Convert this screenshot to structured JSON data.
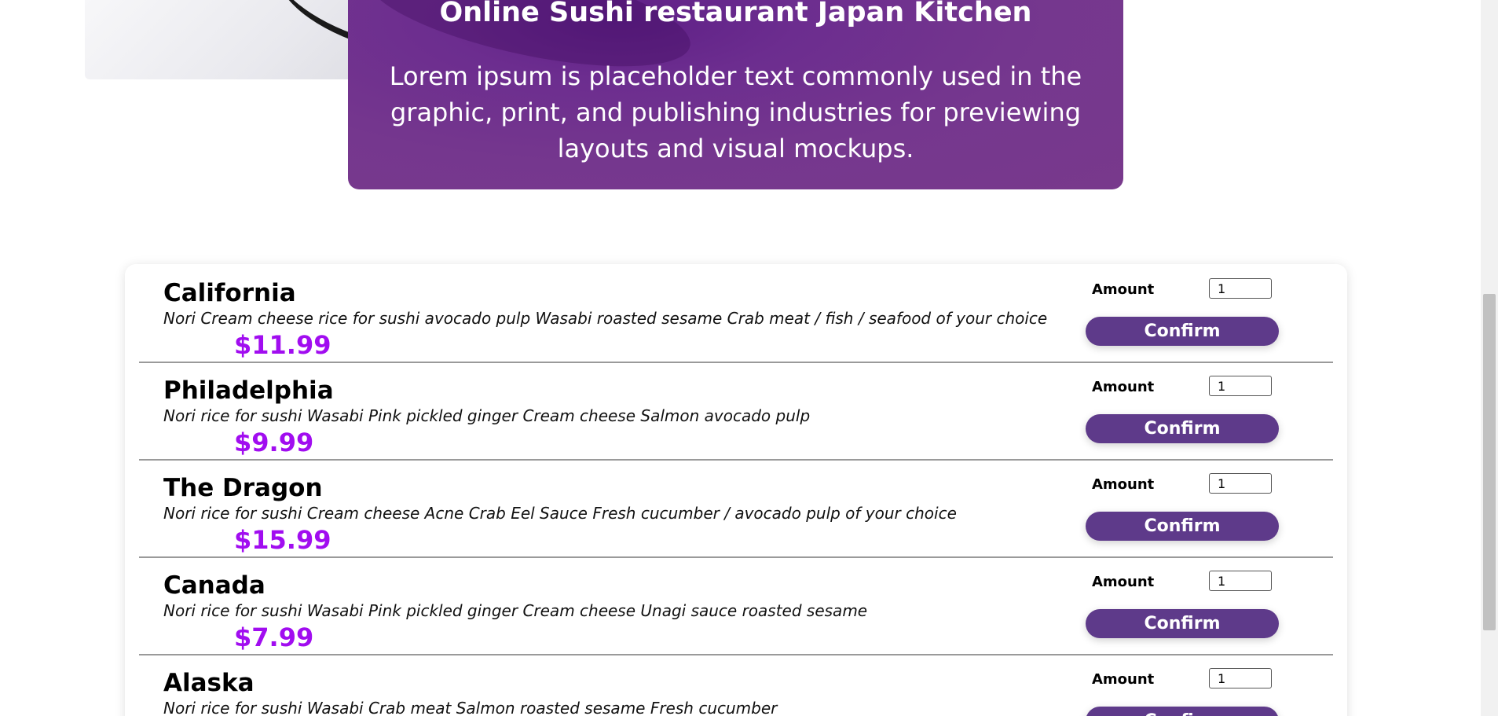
{
  "banner": {
    "title": "Online Sushi restaurant Japan Kitchen",
    "text": "Lorem ipsum is placeholder text commonly used in the graphic, print, and publishing industries for previewing layouts and visual mockups.",
    "color": "#75378e"
  },
  "menu": {
    "amount_label": "Amount",
    "confirm_label": "Confirm",
    "price_color": "#a10df0",
    "button_color": "#5e3a8a",
    "items": [
      {
        "name": "California",
        "description": "Nori Cream cheese rice for sushi avocado pulp Wasabi roasted sesame Crab meat / fish / seafood of your choice",
        "price": "$11.99",
        "amount": "1"
      },
      {
        "name": "Philadelphia",
        "description": "Nori rice for sushi Wasabi Pink pickled ginger Cream cheese Salmon avocado pulp",
        "price": "$9.99",
        "amount": "1"
      },
      {
        "name": "The Dragon",
        "description": "Nori rice for sushi Cream cheese Acne Crab Eel Sauce Fresh cucumber / avocado pulp of your choice",
        "price": "$15.99",
        "amount": "1"
      },
      {
        "name": "Canada",
        "description": "Nori rice for sushi Wasabi Pink pickled ginger Cream cheese Unagi sauce roasted sesame",
        "price": "$7.99",
        "amount": "1"
      },
      {
        "name": "Alaska",
        "description": "Nori rice for sushi Wasabi Crab meat Salmon roasted sesame Fresh cucumber",
        "price": "",
        "amount": "1"
      }
    ]
  }
}
